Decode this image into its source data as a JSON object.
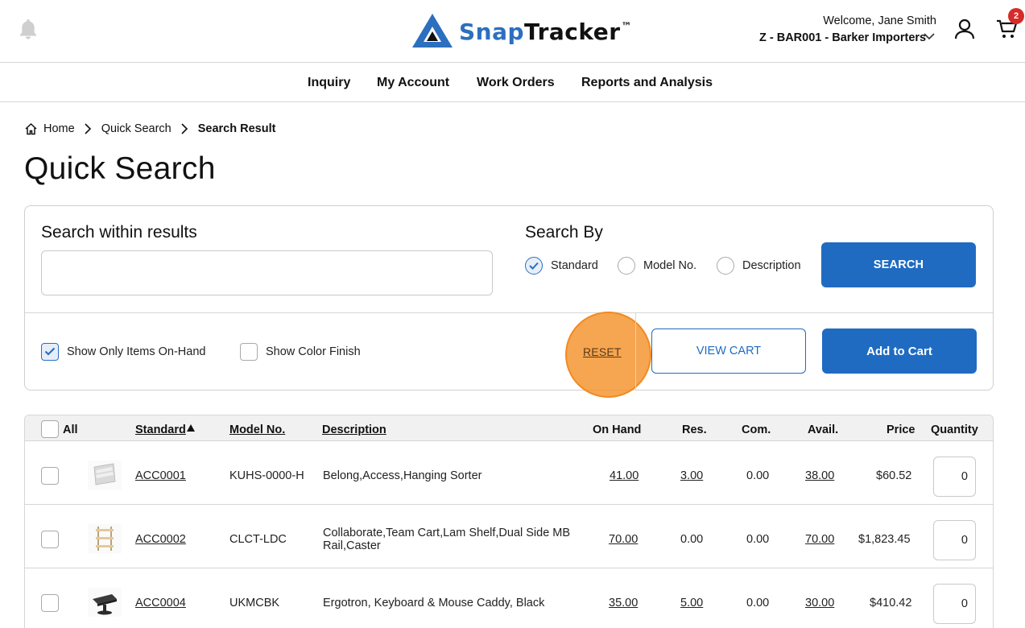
{
  "header": {
    "logo": {
      "snap": "Snap",
      "tracker": "Tracker",
      "tm": "™"
    },
    "welcome": "Welcome, Jane Smith",
    "account": "Z - BAR001 - Barker Importers",
    "cart_count": "2",
    "icons": [
      "bell-icon",
      "logo-icon",
      "chevron-down-icon",
      "user-icon",
      "cart-icon"
    ]
  },
  "nav": {
    "items": [
      {
        "label": "Inquiry"
      },
      {
        "label": "My Account"
      },
      {
        "label": "Work Orders"
      },
      {
        "label": "Reports and Analysis"
      }
    ]
  },
  "breadcrumb": {
    "items": [
      "Home",
      "Quick Search",
      "Search Result"
    ]
  },
  "page": {
    "title": "Quick Search"
  },
  "search": {
    "within_label": "Search within results",
    "within_value": "",
    "within_placeholder": "",
    "search_by_label": "Search By",
    "options": [
      {
        "label": "Standard",
        "checked": true
      },
      {
        "label": "Model No.",
        "checked": false
      },
      {
        "label": "Description",
        "checked": false
      }
    ],
    "search_button": "SEARCH",
    "show_on_hand": {
      "label": "Show Only Items On-Hand",
      "checked": true
    },
    "show_color_finish": {
      "label": "Show Color Finish",
      "checked": false
    },
    "reset": "RESET",
    "view_cart": "VIEW CART",
    "add_to_cart": "Add to Cart"
  },
  "table": {
    "headers": {
      "all": "All",
      "standard": "Standard",
      "model": "Model No.",
      "description": "Description",
      "on_hand": "On Hand",
      "res": "Res.",
      "com": "Com.",
      "avail": "Avail.",
      "price": "Price",
      "quantity": "Quantity"
    },
    "sort": {
      "column": "Standard",
      "direction": "ascending"
    },
    "rows": [
      {
        "standard": "ACC0001",
        "model": "KUHS-0000-H",
        "description": "Belong,Access,Hanging Sorter",
        "on_hand": "41.00",
        "res": "3.00",
        "com": "0.00",
        "avail": "38.00",
        "price": "$60.52",
        "quantity": "0"
      },
      {
        "standard": "ACC0002",
        "model": "CLCT-LDC",
        "description": "Collaborate,Team Cart,Lam Shelf,Dual Side MB Rail,Caster",
        "on_hand": "70.00",
        "res": "0.00",
        "com": "0.00",
        "avail": "70.00",
        "price": "$1,823.45",
        "quantity": "0"
      },
      {
        "standard": "ACC0004",
        "model": "UKMCBK",
        "description": "Ergotron, Keyboard & Mouse Caddy, Black",
        "on_hand": "35.00",
        "res": "5.00",
        "com": "0.00",
        "avail": "30.00",
        "price": "$410.42",
        "quantity": "0"
      }
    ]
  },
  "colors": {
    "primary": "#1f6bc2",
    "logo_blue": "#2c6fbe",
    "badge_red": "#d62b2b",
    "highlight_orange": "#f5952f"
  }
}
